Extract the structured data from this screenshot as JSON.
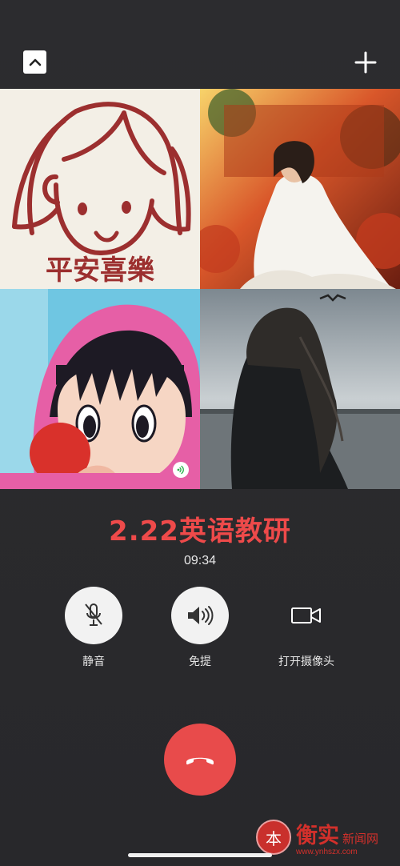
{
  "header": {
    "collapse_icon": "chevron-up-icon",
    "add_icon": "plus-icon"
  },
  "participants": [
    {
      "id": "p1",
      "avatar_text": "平安喜樂"
    },
    {
      "id": "p2"
    },
    {
      "id": "p3",
      "speaking": true
    },
    {
      "id": "p4"
    }
  ],
  "call": {
    "title": "2.22英语教研",
    "timer": "09:34"
  },
  "controls": {
    "mute": {
      "label": "静音",
      "icon": "microphone-off-icon"
    },
    "speaker": {
      "label": "免提",
      "icon": "speaker-icon"
    },
    "camera": {
      "label": "打开摄像头",
      "icon": "video-camera-icon"
    }
  },
  "hangup": {
    "icon": "phone-hangup-icon"
  },
  "watermark": {
    "seal_char": "本",
    "name": "衡实",
    "sub": "新闻网",
    "url": "www.ynhszx.com"
  },
  "colors": {
    "background": "#2a2a2d",
    "title": "#ee4a4a",
    "hangup": "#e84b4b"
  }
}
